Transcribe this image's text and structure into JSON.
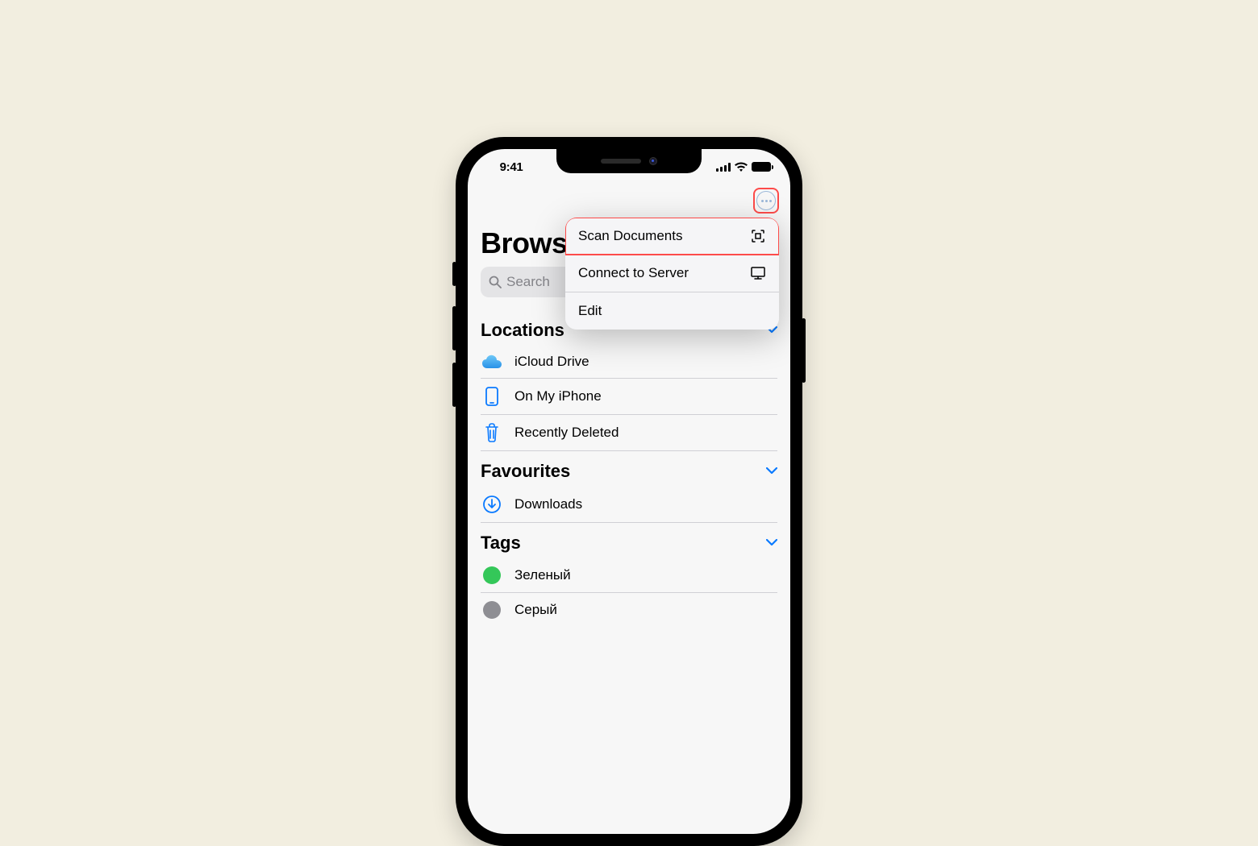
{
  "status": {
    "time": "9:41"
  },
  "nav": {
    "title": "Browse"
  },
  "search": {
    "placeholder": "Search"
  },
  "menu": {
    "items": [
      {
        "label": "Scan Documents",
        "icon": "scan-icon",
        "highlighted": true
      },
      {
        "label": "Connect to Server",
        "icon": "monitor-icon"
      },
      {
        "label": "Edit",
        "icon": ""
      }
    ]
  },
  "sections": {
    "locations": {
      "title": "Locations",
      "items": [
        {
          "label": "iCloud Drive",
          "icon": "cloud-icon"
        },
        {
          "label": "On My iPhone",
          "icon": "phone-icon"
        },
        {
          "label": "Recently Deleted",
          "icon": "trash-icon"
        }
      ]
    },
    "favourites": {
      "title": "Favourites",
      "items": [
        {
          "label": "Downloads",
          "icon": "download-icon"
        }
      ]
    },
    "tags": {
      "title": "Tags",
      "items": [
        {
          "label": "Зеленый",
          "color": "#34c759"
        },
        {
          "label": "Серый",
          "color": "#8e8e93"
        }
      ]
    }
  },
  "highlight_color": "#fd4b4a",
  "accent_color": "#0a7aff"
}
